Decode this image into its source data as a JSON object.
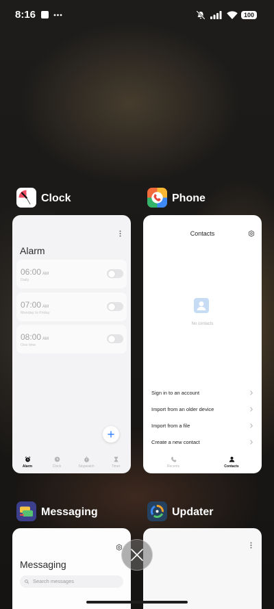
{
  "status_bar": {
    "time": "8:16",
    "battery": "100"
  },
  "colors": {
    "accent": "#3482ff"
  },
  "clock": {
    "label": "Clock",
    "preview": {
      "title": "Alarm",
      "alarms": [
        {
          "time": "06:00",
          "period": "AM",
          "repeat": "Daily",
          "enabled": false
        },
        {
          "time": "07:00",
          "period": "AM",
          "repeat": "Monday to Friday",
          "enabled": false
        },
        {
          "time": "08:00",
          "period": "AM",
          "repeat": "One time",
          "enabled": false
        }
      ],
      "tabs": [
        "Alarm",
        "Clock",
        "Stopwatch",
        "Timer"
      ],
      "active_tab": 0
    }
  },
  "phone": {
    "label": "Phone",
    "preview": {
      "title": "Contacts",
      "empty_text": "No contacts",
      "actions": [
        "Sign in to an account",
        "Import from an older device",
        "Import from a file",
        "Create a new contact"
      ],
      "tabs": [
        "Recents",
        "Contacts"
      ],
      "active_tab": 1
    }
  },
  "messaging": {
    "label": "Messaging",
    "preview": {
      "title": "Messaging",
      "search_placeholder": "Search messages"
    }
  },
  "updater": {
    "label": "Updater"
  }
}
